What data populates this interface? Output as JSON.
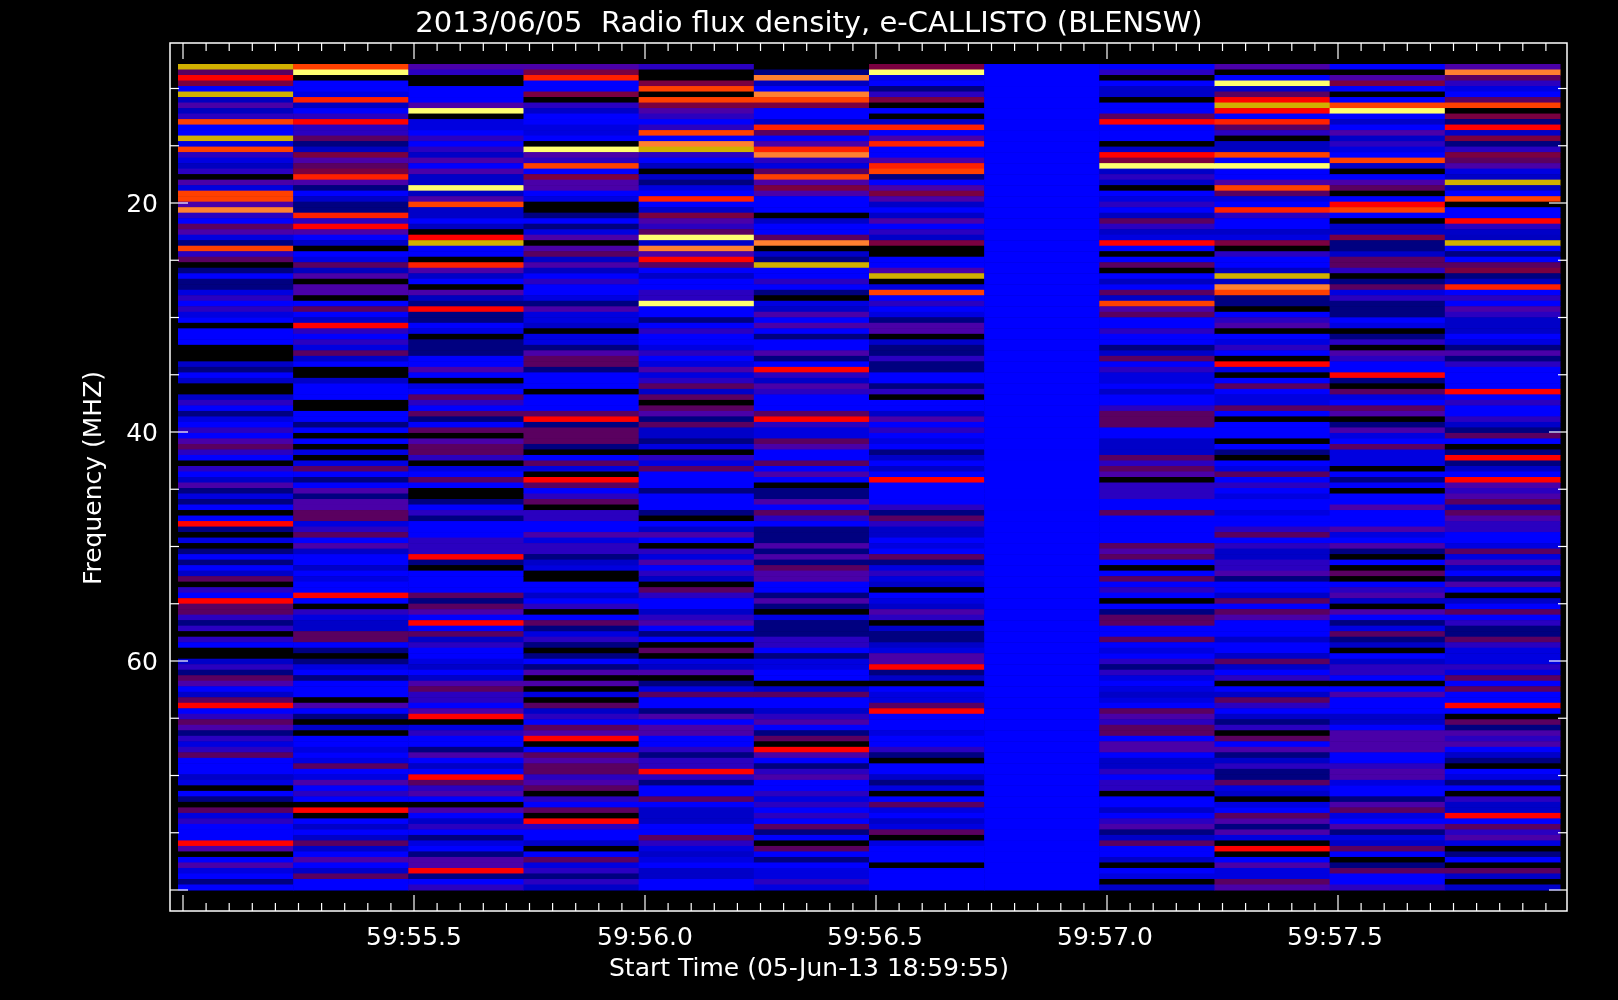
{
  "title": "2013/06/05  Radio flux density, e-CALLISTO (BLENSW)",
  "y_axis": {
    "label": "Frequency (MHZ)",
    "ticks": [
      "20",
      "40",
      "60"
    ]
  },
  "x_axis": {
    "label": "Start Time (05-Jun-13 18:59:55)",
    "ticks": [
      "59:55.5",
      "59:56.0",
      "59:56.5",
      "59:57.0",
      "59:57.5"
    ]
  }
}
